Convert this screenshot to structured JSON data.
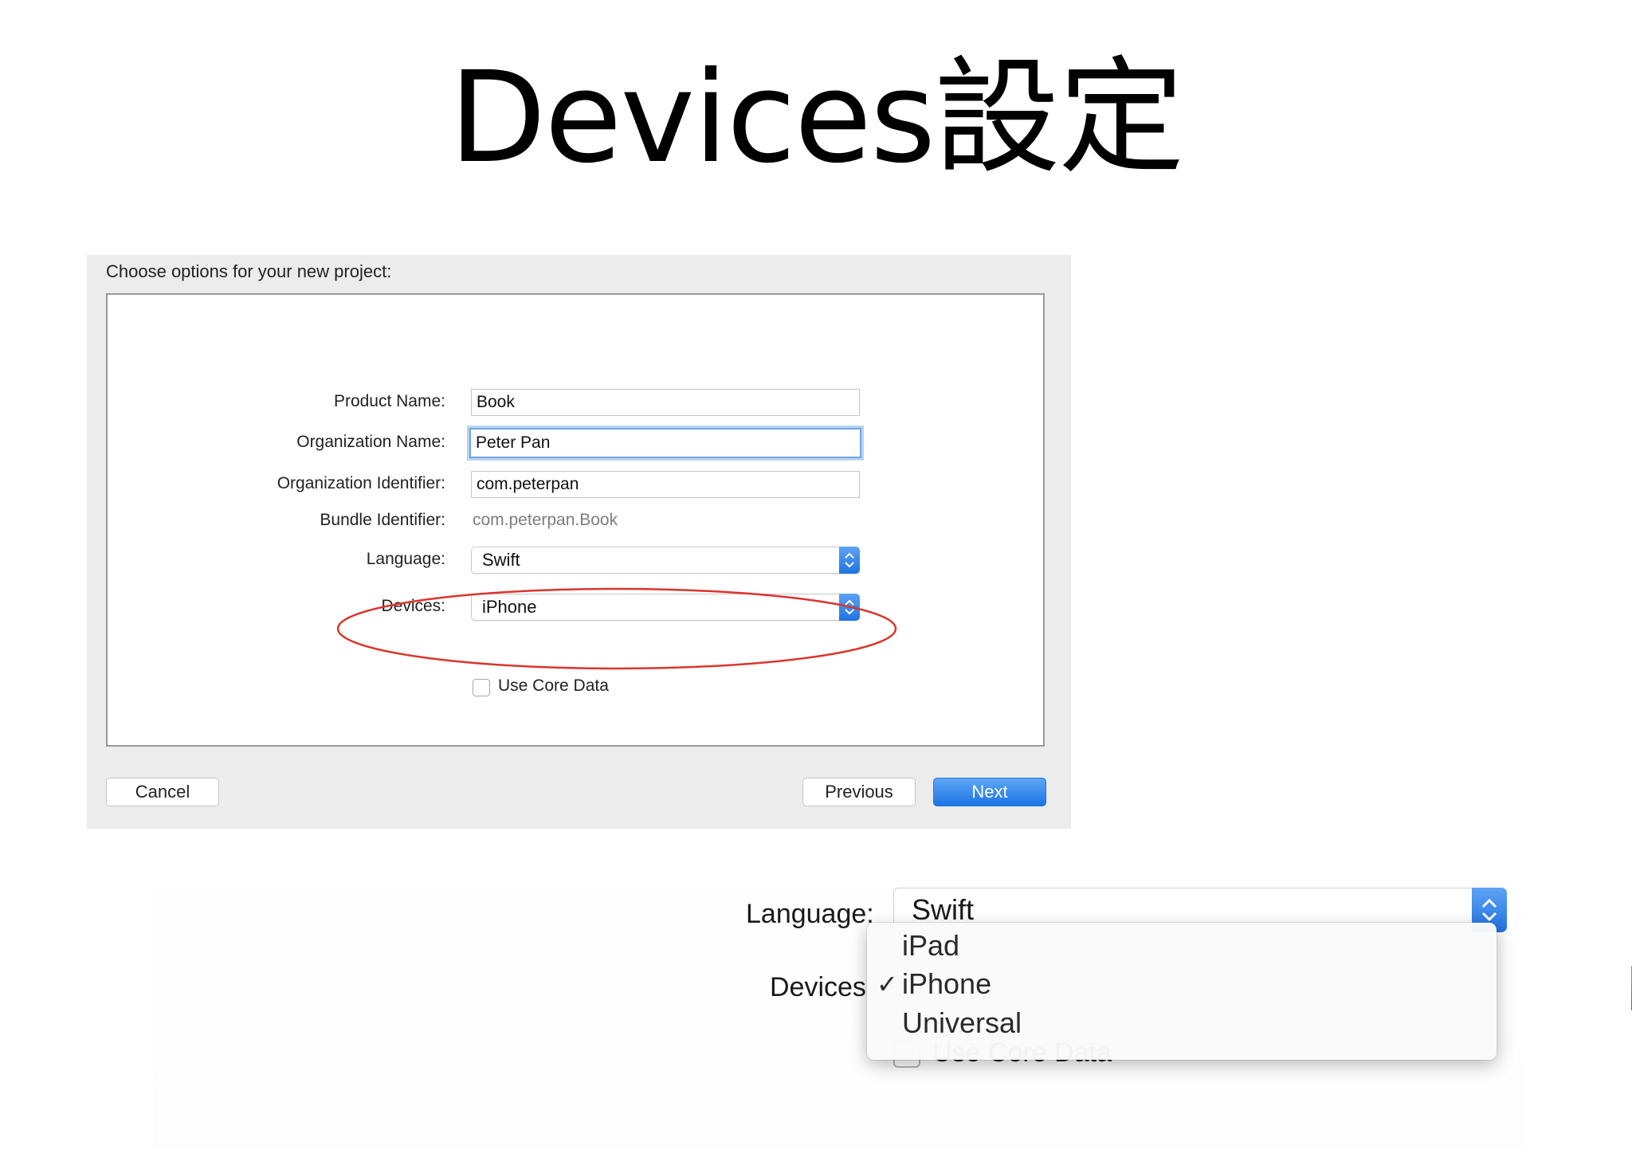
{
  "slide": {
    "title": "Devices設定"
  },
  "dialog": {
    "heading": "Choose options for your new project:",
    "fields": {
      "product_name": {
        "label": "Product Name:",
        "value": "Book"
      },
      "organization_name": {
        "label": "Organization Name:",
        "value": "Peter Pan"
      },
      "organization_identifier": {
        "label": "Organization Identifier:",
        "value": "com.peterpan"
      },
      "bundle_identifier": {
        "label": "Bundle Identifier:",
        "value": "com.peterpan.Book"
      },
      "language": {
        "label": "Language:",
        "value": "Swift"
      },
      "devices": {
        "label": "Devices:",
        "value": "iPhone"
      },
      "use_core_data": {
        "label": "Use Core Data",
        "checked": false
      }
    },
    "buttons": {
      "cancel": "Cancel",
      "previous": "Previous",
      "next": "Next"
    },
    "highlight_color": "#d9362b",
    "accent_color": "#1f73e0"
  },
  "inset": {
    "language_label": "Language:",
    "language_value": "Swift",
    "devices_label": "Devices",
    "use_core_data_label": "Use Core Data",
    "menu": {
      "options": [
        "iPad",
        "iPhone",
        "Universal"
      ],
      "selected": "iPhone",
      "checkmark": "✓"
    }
  }
}
